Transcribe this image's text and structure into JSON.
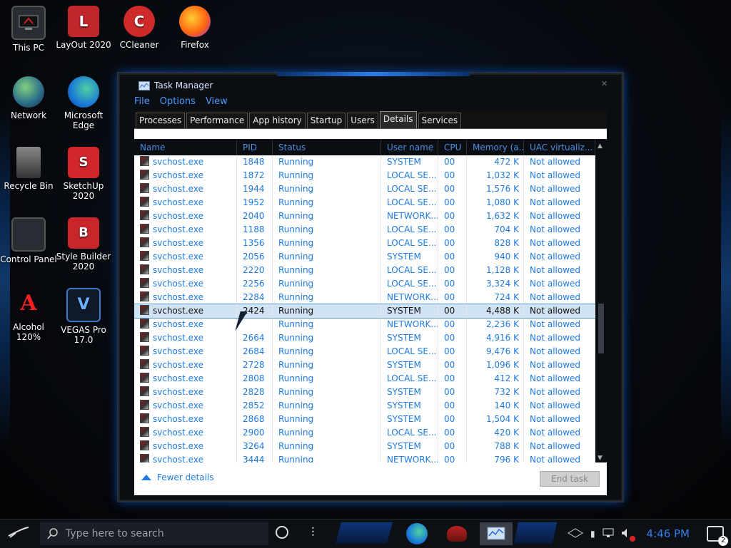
{
  "desktop": {
    "icons": [
      {
        "label": "This PC",
        "icon": "monitor-icon"
      },
      {
        "label": "LayOut 2020",
        "icon": "layout-icon"
      },
      {
        "label": "CCleaner",
        "icon": "ccleaner-icon"
      },
      {
        "label": "Firefox",
        "icon": "firefox-icon"
      },
      {
        "label": "Network",
        "icon": "network-globe-icon"
      },
      {
        "label": "Microsoft Edge",
        "icon": "edge-icon"
      },
      {
        "label": "Recycle Bin",
        "icon": "recycle-bin-icon"
      },
      {
        "label": "SketchUp 2020",
        "icon": "sketchup-icon"
      },
      {
        "label": "Control Panel",
        "icon": "control-panel-icon"
      },
      {
        "label": "Style Builder 2020",
        "icon": "style-builder-icon"
      },
      {
        "label": "Alcohol 120%",
        "icon": "alcohol-icon"
      },
      {
        "label": "VEGAS Pro 17.0",
        "icon": "vegas-icon"
      }
    ]
  },
  "task_manager": {
    "title": "Task Manager",
    "menu": [
      "File",
      "Options",
      "View"
    ],
    "tabs": [
      "Processes",
      "Performance",
      "App history",
      "Startup",
      "Users",
      "Details",
      "Services"
    ],
    "active_tab": "Details",
    "columns": [
      "Name",
      "PID",
      "Status",
      "User name",
      "CPU",
      "Memory (a...",
      "UAC virtualiz..."
    ],
    "rows": [
      {
        "name": "svchost.exe",
        "pid": "1848",
        "status": "Running",
        "user": "SYSTEM",
        "cpu": "00",
        "mem": "472 K",
        "uac": "Not allowed"
      },
      {
        "name": "svchost.exe",
        "pid": "1872",
        "status": "Running",
        "user": "LOCAL SE...",
        "cpu": "00",
        "mem": "1,032 K",
        "uac": "Not allowed"
      },
      {
        "name": "svchost.exe",
        "pid": "1944",
        "status": "Running",
        "user": "LOCAL SE...",
        "cpu": "00",
        "mem": "1,576 K",
        "uac": "Not allowed"
      },
      {
        "name": "svchost.exe",
        "pid": "1952",
        "status": "Running",
        "user": "LOCAL SE...",
        "cpu": "00",
        "mem": "1,080 K",
        "uac": "Not allowed"
      },
      {
        "name": "svchost.exe",
        "pid": "2040",
        "status": "Running",
        "user": "NETWORK...",
        "cpu": "00",
        "mem": "1,632 K",
        "uac": "Not allowed"
      },
      {
        "name": "svchost.exe",
        "pid": "1188",
        "status": "Running",
        "user": "LOCAL SE...",
        "cpu": "00",
        "mem": "704 K",
        "uac": "Not allowed"
      },
      {
        "name": "svchost.exe",
        "pid": "1356",
        "status": "Running",
        "user": "LOCAL SE...",
        "cpu": "00",
        "mem": "828 K",
        "uac": "Not allowed"
      },
      {
        "name": "svchost.exe",
        "pid": "2056",
        "status": "Running",
        "user": "SYSTEM",
        "cpu": "00",
        "mem": "940 K",
        "uac": "Not allowed"
      },
      {
        "name": "svchost.exe",
        "pid": "2220",
        "status": "Running",
        "user": "LOCAL SE...",
        "cpu": "00",
        "mem": "1,128 K",
        "uac": "Not allowed"
      },
      {
        "name": "svchost.exe",
        "pid": "2256",
        "status": "Running",
        "user": "LOCAL SE...",
        "cpu": "00",
        "mem": "3,324 K",
        "uac": "Not allowed"
      },
      {
        "name": "svchost.exe",
        "pid": "2284",
        "status": "Running",
        "user": "NETWORK...",
        "cpu": "00",
        "mem": "724 K",
        "uac": "Not allowed"
      },
      {
        "name": "svchost.exe",
        "pid": "2424",
        "status": "Running",
        "user": "SYSTEM",
        "cpu": "00",
        "mem": "4,488 K",
        "uac": "Not allowed",
        "selected": true
      },
      {
        "name": "svchost.exe",
        "pid": "",
        "status": "Running",
        "user": "NETWORK...",
        "cpu": "00",
        "mem": "2,236 K",
        "uac": "Not allowed"
      },
      {
        "name": "svchost.exe",
        "pid": "2664",
        "status": "Running",
        "user": "SYSTEM",
        "cpu": "00",
        "mem": "4,916 K",
        "uac": "Not allowed"
      },
      {
        "name": "svchost.exe",
        "pid": "2684",
        "status": "Running",
        "user": "LOCAL SE...",
        "cpu": "00",
        "mem": "9,476 K",
        "uac": "Not allowed"
      },
      {
        "name": "svchost.exe",
        "pid": "2728",
        "status": "Running",
        "user": "SYSTEM",
        "cpu": "00",
        "mem": "1,096 K",
        "uac": "Not allowed"
      },
      {
        "name": "svchost.exe",
        "pid": "2808",
        "status": "Running",
        "user": "LOCAL SE...",
        "cpu": "00",
        "mem": "412 K",
        "uac": "Not allowed"
      },
      {
        "name": "svchost.exe",
        "pid": "2828",
        "status": "Running",
        "user": "SYSTEM",
        "cpu": "00",
        "mem": "732 K",
        "uac": "Not allowed"
      },
      {
        "name": "svchost.exe",
        "pid": "2852",
        "status": "Running",
        "user": "SYSTEM",
        "cpu": "00",
        "mem": "140 K",
        "uac": "Not allowed"
      },
      {
        "name": "svchost.exe",
        "pid": "2868",
        "status": "Running",
        "user": "SYSTEM",
        "cpu": "00",
        "mem": "1,504 K",
        "uac": "Not allowed"
      },
      {
        "name": "svchost.exe",
        "pid": "2900",
        "status": "Running",
        "user": "LOCAL SE...",
        "cpu": "00",
        "mem": "420 K",
        "uac": "Not allowed"
      },
      {
        "name": "svchost.exe",
        "pid": "3264",
        "status": "Running",
        "user": "SYSTEM",
        "cpu": "00",
        "mem": "788 K",
        "uac": "Not allowed"
      },
      {
        "name": "svchost.exe",
        "pid": "3444",
        "status": "Running",
        "user": "NETWORK...",
        "cpu": "00",
        "mem": "796 K",
        "uac": "Not allowed"
      }
    ],
    "fewer_details": "Fewer details",
    "end_task": "End task"
  },
  "taskbar": {
    "search_placeholder": "Type here to search",
    "clock": "4:46 PM",
    "notification_count": "2"
  },
  "colors": {
    "accent": "#1e7be2",
    "clock": "#2f7be8",
    "window_glow": "#0a55c8"
  }
}
